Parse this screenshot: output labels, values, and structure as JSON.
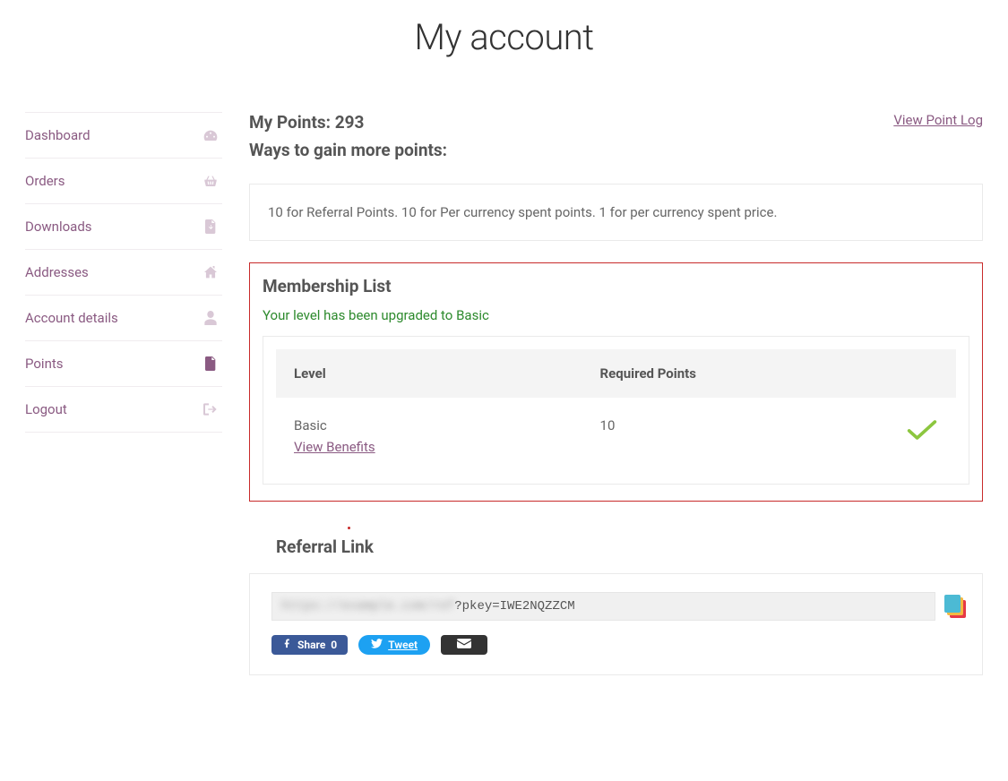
{
  "page_title": "My account",
  "sidebar": {
    "items": [
      {
        "label": "Dashboard",
        "icon": "dashboard"
      },
      {
        "label": "Orders",
        "icon": "basket"
      },
      {
        "label": "Downloads",
        "icon": "file"
      },
      {
        "label": "Addresses",
        "icon": "home"
      },
      {
        "label": "Account details",
        "icon": "user"
      },
      {
        "label": "Points",
        "icon": "doc",
        "active": true
      },
      {
        "label": "Logout",
        "icon": "signout"
      }
    ]
  },
  "points": {
    "label": "My Points:",
    "value": "293",
    "view_log": "View Point Log",
    "ways_title": "Ways to gain more points:",
    "ways_text": "10 for Referral Points. 10 for Per currency spent points. 1 for per currency spent price."
  },
  "membership": {
    "title": "Membership List",
    "upgrade_msg": "Your level has been upgraded to Basic",
    "columns": {
      "level": "Level",
      "required": "Required Points"
    },
    "rows": [
      {
        "level": "Basic",
        "required": "10",
        "benefits_label": "View Benefits",
        "achieved": true
      }
    ]
  },
  "referral": {
    "title": "Referral Link",
    "link_visible_suffix": "?pkey=IWE2NQZZCM",
    "link_blur_prefix": "https://example.com/ref"
  },
  "social": {
    "fb_label": "Share",
    "fb_count": "0",
    "tw_label": "Tweet"
  }
}
